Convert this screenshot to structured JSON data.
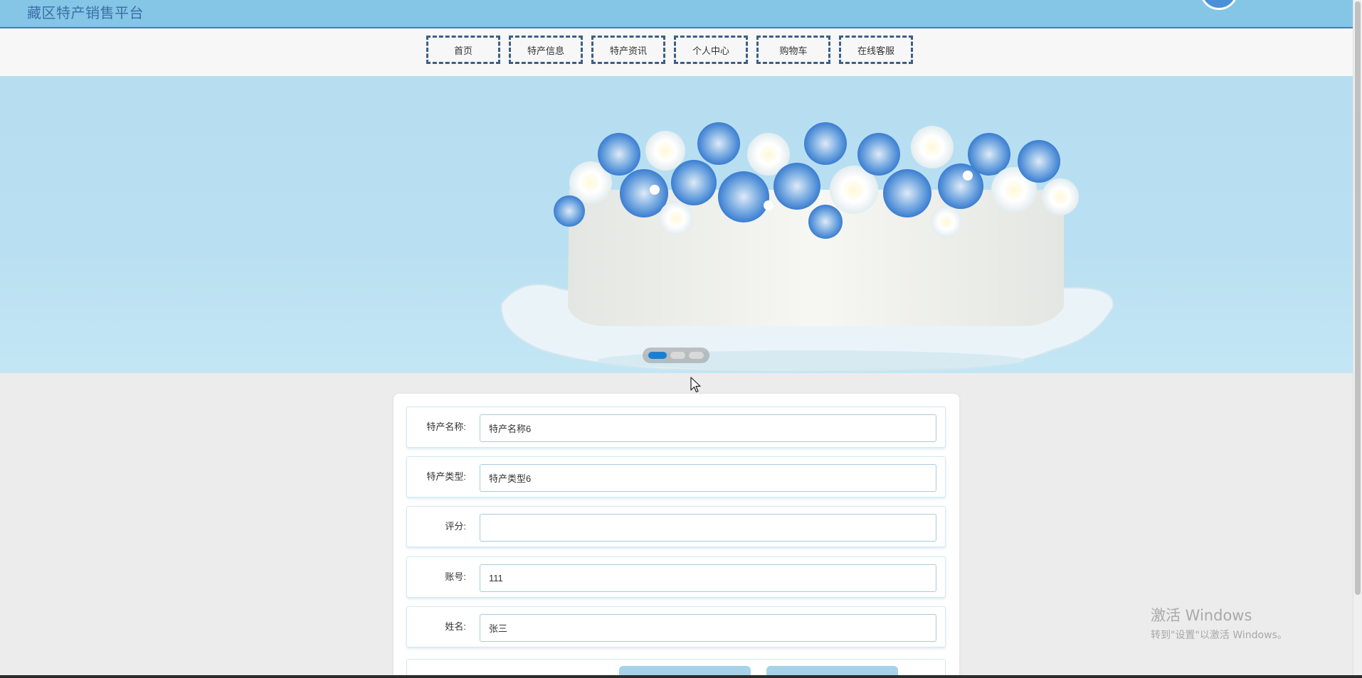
{
  "header": {
    "site_title": "藏区特产销售平台"
  },
  "nav": {
    "items": [
      {
        "label": "首页"
      },
      {
        "label": "特产信息"
      },
      {
        "label": "特产资讯"
      },
      {
        "label": "个人中心"
      },
      {
        "label": "购物车"
      },
      {
        "label": "在线客服"
      }
    ]
  },
  "banner": {
    "slide_count": 3,
    "active_slide": 1
  },
  "form": {
    "fields": [
      {
        "label": "特产名称:",
        "value": "特产名称6",
        "placeholder": ""
      },
      {
        "label": "特产类型:",
        "value": "特产类型6",
        "placeholder": ""
      },
      {
        "label": "评分:",
        "value": "",
        "placeholder": ""
      },
      {
        "label": "账号:",
        "value": "111",
        "placeholder": ""
      },
      {
        "label": "姓名:",
        "value": "张三",
        "placeholder": ""
      }
    ],
    "submit_label": "",
    "reset_label": ""
  },
  "watermark": {
    "title": "激活 Windows",
    "subtitle": "转到\"设置\"以激活 Windows。"
  },
  "colors": {
    "header_bg": "#85c6e6",
    "header_border": "#3d7eb0",
    "nav_border": "#3a5f87",
    "dot_active": "#1a7fd2",
    "input_border": "#a8cbdc",
    "button_bg": "#a6d2ea"
  }
}
